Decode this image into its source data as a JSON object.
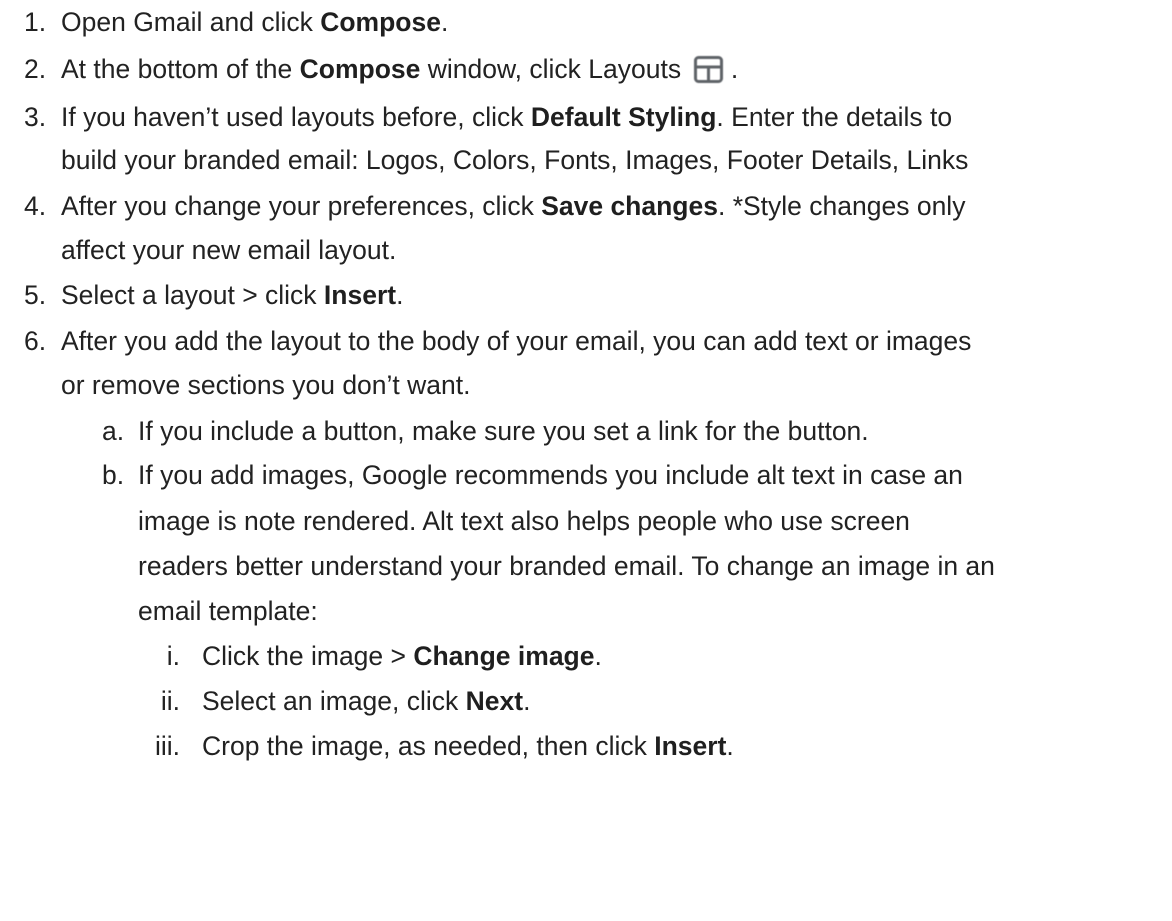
{
  "steps": [
    {
      "num": "1.",
      "parts": [
        {
          "t": "Open Gmail and click "
        },
        {
          "b": "Compose"
        },
        {
          "t": "."
        }
      ]
    },
    {
      "num": "2.",
      "parts": [
        {
          "t": "At the bottom of the "
        },
        {
          "b": "Compose"
        },
        {
          "t": " window, click Layouts "
        },
        {
          "icon": "layouts-icon"
        },
        {
          "t": " ."
        }
      ]
    },
    {
      "num": "3.",
      "parts": [
        {
          "t": "If you haven’t used layouts before, click "
        },
        {
          "b": "Default Styling"
        },
        {
          "t": ".  Enter the details to"
        }
      ]
    },
    {
      "num": "",
      "parts": [
        {
          "t": "build your branded email: Logos, Colors, Fonts, Images, Footer Details, Links"
        }
      ]
    },
    {
      "num": "4.",
      "parts": [
        {
          "t": "After you change your preferences, click "
        },
        {
          "b": "Save changes"
        },
        {
          "t": ".  *Style changes only"
        }
      ]
    },
    {
      "num": "",
      "parts": [
        {
          "t": "affect your new email layout."
        }
      ]
    },
    {
      "num": "5.",
      "parts": [
        {
          "t": "Select a layout > click "
        },
        {
          "b": "Insert"
        },
        {
          "t": "."
        }
      ]
    },
    {
      "num": "6.",
      "parts": [
        {
          "t": "After you add the layout to the body of your email, you can add text or images"
        }
      ]
    },
    {
      "num": "",
      "parts": [
        {
          "t": "or remove sections you don’t want."
        }
      ]
    },
    {
      "num": "a.",
      "parts": [
        {
          "t": "If you include a button, make sure you set a link for the button."
        }
      ]
    },
    {
      "num": "b.",
      "parts": [
        {
          "t": "If you add images, Google recommends you include alt text in case an"
        }
      ]
    },
    {
      "num": "",
      "parts": [
        {
          "t": "image is note rendered.  Alt text also helps people who use screen"
        }
      ]
    },
    {
      "num": "",
      "parts": [
        {
          "t": "readers better understand your branded email.  To change an image in an"
        }
      ]
    },
    {
      "num": "",
      "parts": [
        {
          "t": "email template:"
        }
      ]
    },
    {
      "num": "i.",
      "parts": [
        {
          "t": "Click the image > "
        },
        {
          "b": "Change image"
        },
        {
          "t": "."
        }
      ]
    },
    {
      "num": "ii.",
      "parts": [
        {
          "t": "Select an image, click "
        },
        {
          "b": "Next"
        },
        {
          "t": "."
        }
      ]
    },
    {
      "num": "iii.",
      "parts": [
        {
          "t": "Crop the image, as needed, then click "
        },
        {
          "b": "Insert"
        },
        {
          "t": "."
        }
      ]
    }
  ],
  "colors": {
    "text": "#222222",
    "icon": "#5f6368"
  }
}
